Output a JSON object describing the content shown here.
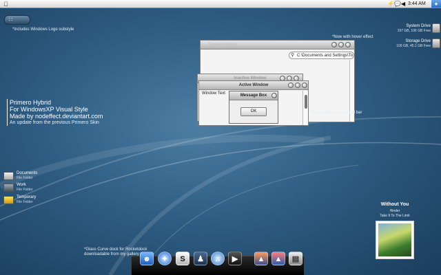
{
  "menubar": {
    "clock": "3:44 AM"
  },
  "start_button": {
    "label": "∷"
  },
  "notes": {
    "logo_substyle": "*Includes Windows Logo substyle",
    "hover_effect": "*Now with hover effect",
    "new_buttons": "*New buttons and scroll bar",
    "rocketdock_line1": "*Glass Curve dock for Rocketdock",
    "rocketdock_line2": "downloadable from my gallery"
  },
  "drives": [
    {
      "name": "System Drive",
      "free": "197 GB, 106 GB Free"
    },
    {
      "name": "Storage Drive",
      "free": "100 GB, 45.1 GB Free"
    }
  ],
  "primero": {
    "line1": "Primero Hybrid",
    "line2": "For WindowsXP Visual Style",
    "line3": "Made by nodeffect.deviantart.com",
    "line4": "An update from the previous Primero Skin"
  },
  "windows": {
    "explorer_title": "Primero Hybrid",
    "address": "C:\\Documents and Settings\\To",
    "inactive_title": "Inactive Window",
    "active_title": "Active Window",
    "window_text": "Window Text",
    "message_title": "Message Box",
    "ok_label": "OK"
  },
  "folders": [
    {
      "name": "Documents",
      "type": "File Folder"
    },
    {
      "name": "Work",
      "type": "File Folder"
    },
    {
      "name": "Temporary",
      "type": "File Folder"
    }
  ],
  "now_playing": {
    "title": "Without You",
    "artist": "Hinder",
    "album": "Take It To The Limit"
  },
  "dock_icons": [
    "finder-icon",
    "safari-icon",
    "skype-icon",
    "person-icon",
    "itunes-icon",
    "video-icon",
    "photo-icon",
    "photo2-icon",
    "trash-icon"
  ]
}
